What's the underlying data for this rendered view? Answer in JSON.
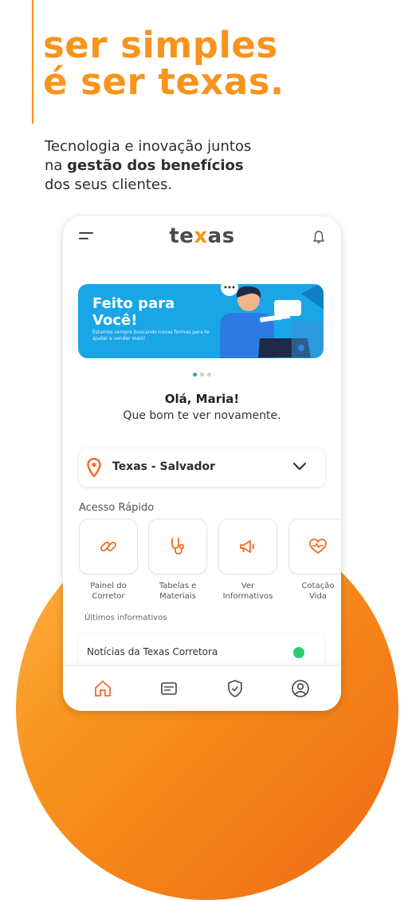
{
  "hero": {
    "headline_line1": "ser simples",
    "headline_line2": "é ser texas.",
    "sub_line1": "Tecnologia e inovação juntos",
    "sub_prefix": "na ",
    "sub_bold": "gestão dos benefícios",
    "sub_line3": "dos seus clientes."
  },
  "app": {
    "logo_left": "te",
    "logo_x": "x",
    "logo_right": "as",
    "icons": {
      "menu": "menu-icon",
      "bell": "bell-icon"
    },
    "banner": {
      "title_line1": "Feito para",
      "title_line2": "Você!",
      "subtitle": "Estamos sempre buscando novas formas para te ajudar a vender mais!",
      "slide_index": 1,
      "slide_count": 3
    },
    "greeting": "Olá, Maria!",
    "greeting_sub": "Que bom te ver novamente.",
    "selector": {
      "value": "Texas - Salvador"
    },
    "quick_access": {
      "title": "Acesso Rápido",
      "items": [
        {
          "line1": "Painel do",
          "line2": "Corretor",
          "icon": "link-icon"
        },
        {
          "line1": "Tabelas e",
          "line2": "Materiais",
          "icon": "stethoscope-icon"
        },
        {
          "line1": "Ver",
          "line2": "Informativos",
          "icon": "megaphone-icon"
        },
        {
          "line1": "Cotação",
          "line2": "Vida",
          "icon": "heart-pulse-icon"
        }
      ]
    },
    "news": {
      "header": "Últimos informativos",
      "items": [
        {
          "title": "Notícias da Texas Corretora",
          "status_color": "#2ecc71"
        }
      ]
    },
    "bottom_nav": [
      "home-icon",
      "document-icon",
      "shield-icon",
      "user-icon"
    ]
  },
  "colors": {
    "brand_orange": "#f7941d",
    "banner_blue": "#1aa6e6",
    "text_dark": "#2d2d2d"
  }
}
